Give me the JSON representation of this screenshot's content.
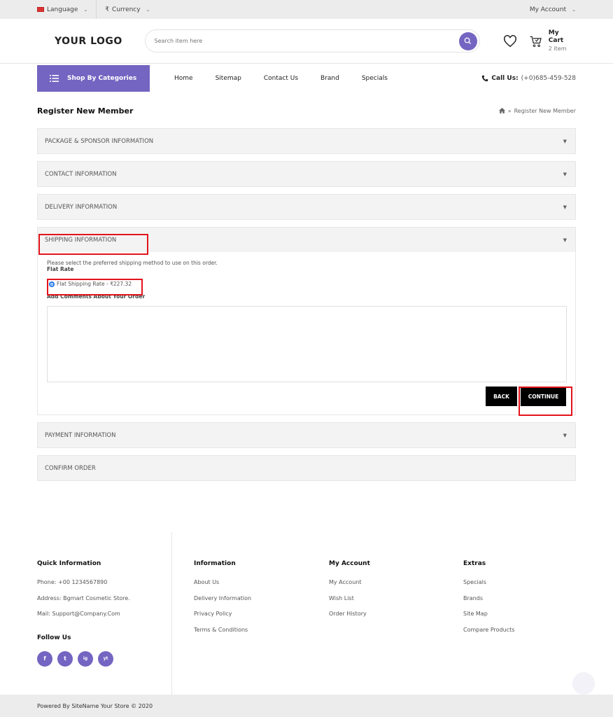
{
  "topbar": {
    "language": "Language",
    "currency_symbol": "₹",
    "currency": "Currency",
    "account": "My Account"
  },
  "header": {
    "logo": "YOUR LOGO",
    "search_placeholder": "Search item here",
    "cart_title": "My Cart",
    "cart_count": "2 item"
  },
  "nav": {
    "categories_label": "Shop By Categories",
    "items": [
      "Home",
      "Sitemap",
      "Contact Us",
      "Brand",
      "Specials"
    ],
    "call_label": "Call Us:",
    "phone": "(+0)685-459-528"
  },
  "page": {
    "title": "Register New Member",
    "breadcrumb_sep": "»",
    "breadcrumb": "Register New Member"
  },
  "accordion": {
    "sections": [
      "PACKAGE & SPONSOR INFORMATION",
      "CONTACT INFORMATION",
      "DELIVERY INFORMATION",
      "SHIPPING INFORMATION",
      "PAYMENT INFORMATION",
      "CONFIRM ORDER"
    ]
  },
  "shipping": {
    "instruction": "Please select the preferred shipping method to use on this order.",
    "method_title": "Flat Rate",
    "option_label": "Flat Shipping Rate - ₹227.32",
    "comments_label": "Add Comments About Your Order",
    "comments_value": "",
    "back_label": "BACK",
    "continue_label": "CONTINUE"
  },
  "footer": {
    "quick": {
      "title": "Quick Information",
      "phone": "Phone:  +00 1234567890",
      "address": "Address:  Bgmart Cosmetic Store.",
      "mail": "Mail:  Support@Company.Com",
      "follow": "Follow Us"
    },
    "information": {
      "title": "Information",
      "links": [
        "About Us",
        "Delivery Information",
        "Privacy Policy",
        "Terms & Conditions"
      ]
    },
    "account": {
      "title": "My Account",
      "links": [
        "My Account",
        "Wish List",
        "Order History"
      ]
    },
    "extras": {
      "title": "Extras",
      "links": [
        "Specials",
        "Brands",
        "Site Map",
        "Compare Products"
      ]
    },
    "social": [
      "f",
      "t",
      "ig",
      "yt"
    ],
    "copyright": "Powered By SiteName Your Store © 2020"
  },
  "colors": {
    "accent": "#7365c1",
    "highlight": "#e3131b",
    "button": "#000000"
  }
}
